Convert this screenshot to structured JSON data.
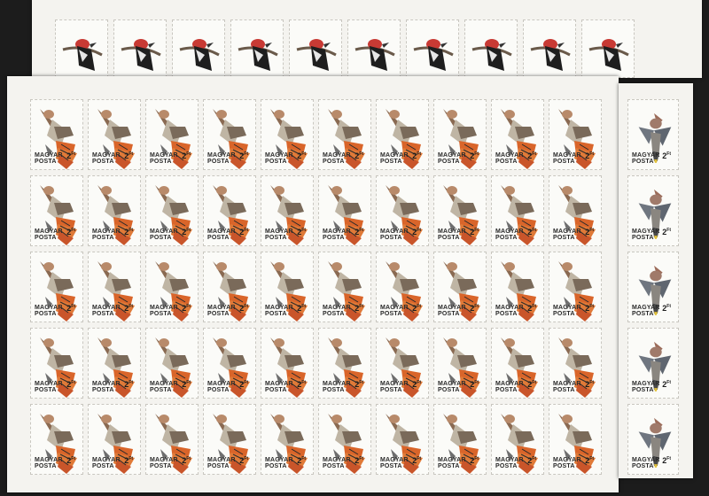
{
  "stamp": {
    "country": "MAGYAR POSTA",
    "value": "2",
    "currency": "Ft"
  },
  "sheets": [
    {
      "name": "back-sheet",
      "rows": 1,
      "cols": 10,
      "subject": "black woodpecker with red crest"
    },
    {
      "name": "front-sheet",
      "rows": 5,
      "cols": 10,
      "subject": "orange-tailed woodpecker in flight"
    },
    {
      "name": "side-sheet",
      "rows": 5,
      "cols": 1,
      "subject": "grey crested waxwing"
    }
  ],
  "colors": {
    "background": "#1c1c1c",
    "paper": "#f4f3ef",
    "tail_orange": "#d9652a",
    "crest_red": "#c83a34"
  }
}
